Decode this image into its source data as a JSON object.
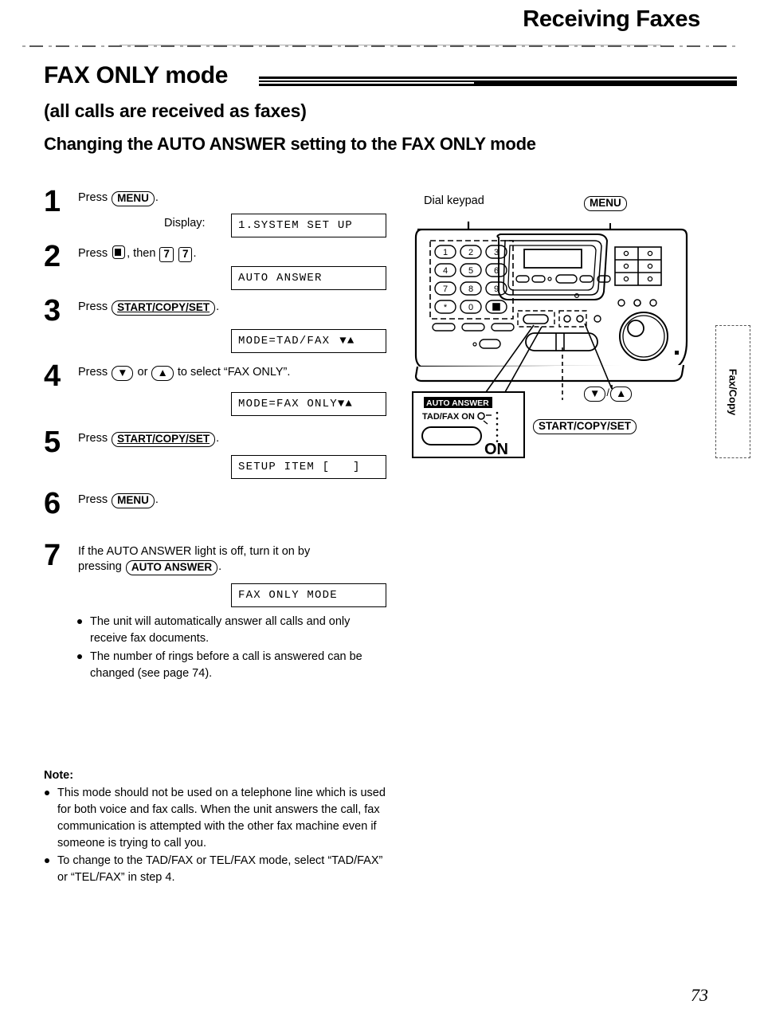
{
  "header": {
    "title": "Receiving Faxes"
  },
  "titles": {
    "section": "FAX ONLY mode",
    "subtitle": "(all calls are received as faxes)",
    "sub_subtitle": "Changing the AUTO ANSWER setting to the FAX ONLY mode"
  },
  "steps": [
    {
      "number": "1",
      "text_parts": {
        "press": "Press",
        "key": "MENU",
        "after": "."
      },
      "display_label": "Display:",
      "lcd": "1.SYSTEM SET UP"
    },
    {
      "number": "2",
      "text_parts": {
        "press": "Press",
        "mid": ", then",
        "key1": "7",
        "key2": "7",
        "after": "."
      },
      "lcd": "AUTO ANSWER"
    },
    {
      "number": "3",
      "text_parts": {
        "press": "Press",
        "key": "START/COPY/SET",
        "after": "."
      },
      "lcd": "MODE=TAD/FAX",
      "lcd_arrows": "▼▲"
    },
    {
      "number": "4",
      "text_parts": {
        "press": "Press",
        "or": "or",
        "tail": "to select “FAX ONLY”.",
        "down": "▼",
        "up": "▲"
      },
      "lcd": "MODE=FAX ONLY",
      "lcd_arrows": "▼▲"
    },
    {
      "number": "5",
      "text_parts": {
        "press": "Press",
        "key": "START/COPY/SET",
        "after": "."
      },
      "lcd": "SETUP ITEM [   ]"
    },
    {
      "number": "6",
      "text_parts": {
        "press": "Press",
        "key": "MENU",
        "after": "."
      }
    },
    {
      "number": "7",
      "text_parts": {
        "line1": "If the AUTO ANSWER light is off, turn it on by",
        "line2_pre": "pressing",
        "key": "AUTO ANSWER",
        "after": "."
      },
      "lcd": "FAX ONLY MODE"
    }
  ],
  "bullets": [
    "The unit will automatically answer all calls and only receive fax documents.",
    "The number of rings before a call is answered can be changed (see page 74)."
  ],
  "note": {
    "title": "Note:",
    "items": [
      "This mode should not be used on a telephone line which is used for both voice and fax calls. When the unit answers the call, fax communication is attempted with the other fax machine even if someone is trying to call you.",
      "To change to the TAD/FAX or TEL/FAX mode, select “TAD/FAX” or “TEL/FAX” in step 4."
    ]
  },
  "diagram": {
    "callouts": {
      "dial_keypad": "Dial keypad",
      "menu": "MENU",
      "start_copy_set": "START/COPY/SET",
      "updown": "/",
      "down": "▼",
      "up": "▲"
    },
    "keypad_keys": [
      "1",
      "2",
      "3",
      "4",
      "5",
      "6",
      "7",
      "8",
      "9",
      "*",
      "0",
      "#"
    ],
    "auto_answer_inset": {
      "label": "AUTO ANSWER",
      "sub_label": "TAD/FAX ON",
      "on": "ON"
    }
  },
  "side_tab": {
    "label": "Fax/Copy"
  },
  "page_number": "73"
}
